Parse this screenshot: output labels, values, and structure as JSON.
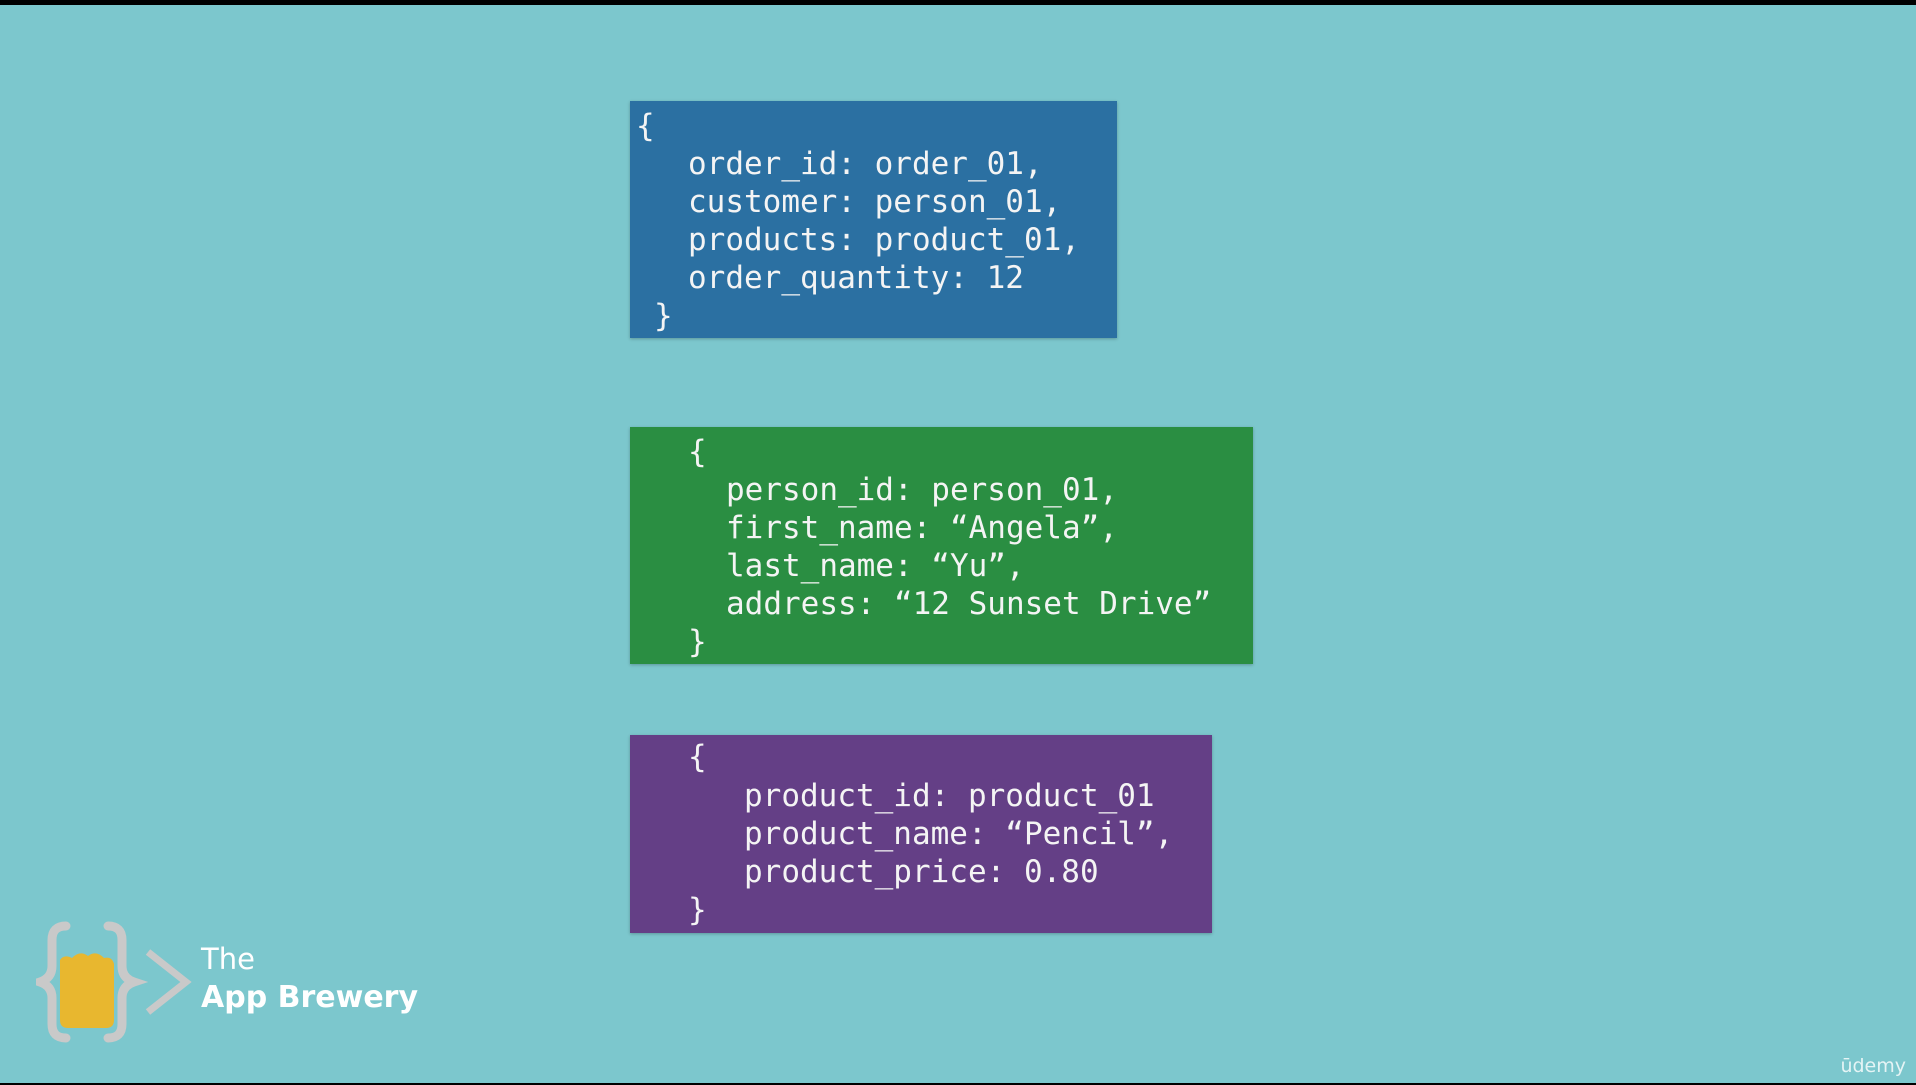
{
  "colors": {
    "background": "#7cc7cd",
    "order_card": "#2b70a2",
    "person_card": "#2a8e42",
    "product_card": "#643f86",
    "logo_cup": "#e8b72f",
    "logo_bracket": "#c9c9c9"
  },
  "order_card": {
    "lines": [
      "{",
      "order_id: order_01,",
      "customer: person_01,",
      "products: product_01,",
      "order_quantity: 12",
      "}"
    ]
  },
  "person_card": {
    "lines": [
      "{",
      "person_id: person_01,",
      "first_name: “Angela”,",
      "last_name: “Yu”,",
      "address: “12 Sunset Drive”",
      "}"
    ]
  },
  "product_card": {
    "lines": [
      "{",
      "product_id: product_01",
      "product_name: “Pencil”,",
      "product_price: 0.80",
      "}"
    ]
  },
  "logo": {
    "line1": "The",
    "line2": "App Brewery",
    "icon": "app-brewery-logo-icon"
  },
  "watermark": "ūdemy"
}
